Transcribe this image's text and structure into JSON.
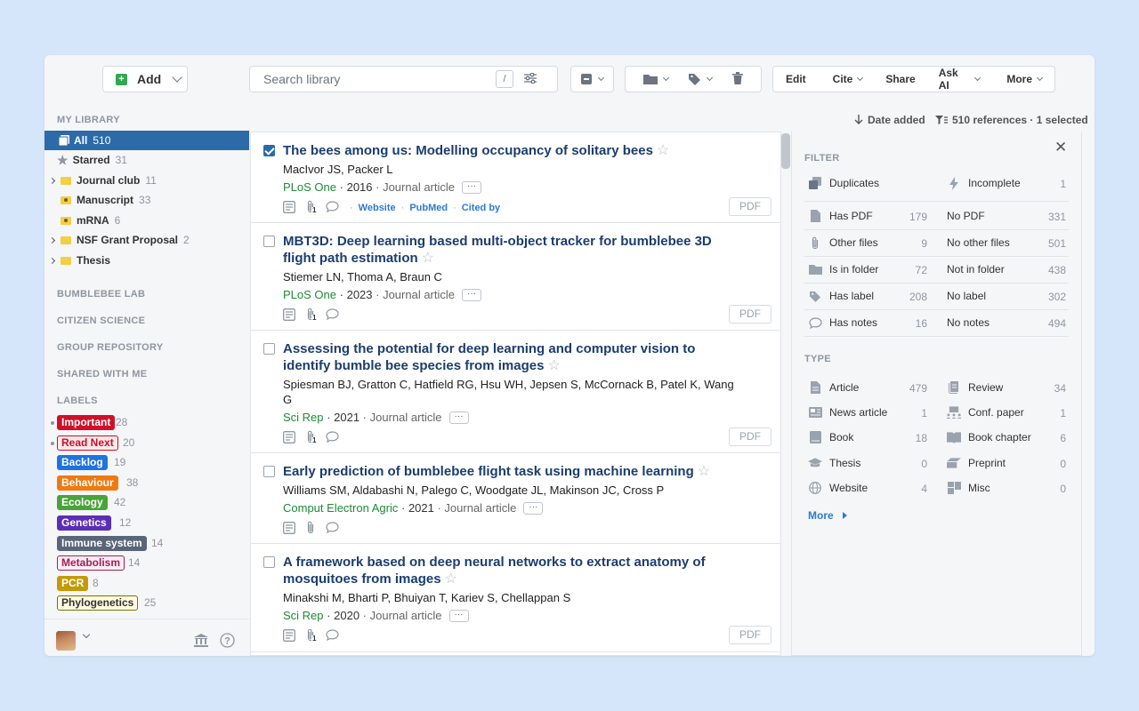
{
  "toolbar": {
    "add_label": "Add",
    "search_placeholder": "Search library",
    "slash_key": "/",
    "actions": [
      "Edit",
      "Cite",
      "Share",
      "Ask AI",
      "More"
    ]
  },
  "sidebar": {
    "my_library": "MY LIBRARY",
    "items": [
      {
        "label": "All",
        "count": "510"
      },
      {
        "label": "Starred",
        "count": "31"
      },
      {
        "label": "Journal club",
        "count": "11"
      },
      {
        "label": "Manuscript",
        "count": "33"
      },
      {
        "label": "mRNA",
        "count": "6"
      },
      {
        "label": "NSF Grant Proposal",
        "count": "2"
      },
      {
        "label": "Thesis",
        "count": ""
      }
    ],
    "groups": [
      "BUMBLEBEE LAB",
      "CITIZEN SCIENCE",
      "GROUP REPOSITORY",
      "SHARED WITH ME"
    ],
    "labels_heading": "LABELS",
    "labels": [
      {
        "name": "Important",
        "count": "28",
        "bg": "#d0102a",
        "fg": "#ffffff",
        "border": "#d0102a"
      },
      {
        "name": "Read Next",
        "count": "20",
        "bg": "#fde8ea",
        "fg": "#c81028",
        "border": "#c81028"
      },
      {
        "name": "Backlog",
        "count": "19",
        "bg": "#1f73e0",
        "fg": "#ffffff",
        "border": "#1f73e0"
      },
      {
        "name": "Behaviour",
        "count": "38",
        "bg": "#ef7a12",
        "fg": "#ffffff",
        "border": "#ef7a12"
      },
      {
        "name": "Ecology",
        "count": "42",
        "bg": "#4aa33a",
        "fg": "#ffffff",
        "border": "#4aa33a"
      },
      {
        "name": "Genetics",
        "count": "12",
        "bg": "#5b2fb5",
        "fg": "#ffffff",
        "border": "#5b2fb5"
      },
      {
        "name": "Immune system",
        "count": "14",
        "bg": "#5a6577",
        "fg": "#ffffff",
        "border": "#5a6577"
      },
      {
        "name": "Metabolism",
        "count": "14",
        "bg": "#fbeef3",
        "fg": "#a0205a",
        "border": "#a0205a"
      },
      {
        "name": "PCR",
        "count": "8",
        "bg": "#c49a06",
        "fg": "#ffffff",
        "border": "#c49a06"
      },
      {
        "name": "Phylogenetics",
        "count": "25",
        "bg": "#fefbe0",
        "fg": "#333333",
        "border": "#7a7400"
      }
    ]
  },
  "list_header": {
    "sort": "Date added",
    "summary": "510 references · 1 selected"
  },
  "references": [
    {
      "title": "The bees among us: Modelling occupancy of solitary bees",
      "authors": "MacIvor JS, Packer L",
      "journal": "PLoS One",
      "year": "2016",
      "type": "Journal article",
      "links": [
        "Website",
        "PubMed",
        "Cited by"
      ],
      "pdf": "PDF",
      "checked": true,
      "clip": "1"
    },
    {
      "title": "MBT3D: Deep learning based multi-object tracker for bumblebee 3D flight path estimation",
      "authors": "Stiemer LN, Thoma A, Braun C",
      "journal": "PLoS One",
      "year": "2023",
      "type": "Journal article",
      "links": [],
      "pdf": "PDF",
      "checked": false,
      "clip": "1"
    },
    {
      "title": "Assessing the potential for deep learning and computer vision to identify bumble bee species from images",
      "authors": "Spiesman BJ, Gratton C, Hatfield RG, Hsu WH, Jepsen S, McCornack B, Patel K, Wang G",
      "journal": "Sci Rep",
      "year": "2021",
      "type": "Journal article",
      "links": [],
      "pdf": "PDF",
      "checked": false,
      "clip": "1"
    },
    {
      "title": "Early prediction of bumblebee flight task using machine learning",
      "authors": "Williams SM, Aldabashi N, Palego C, Woodgate JL, Makinson JC, Cross P",
      "journal": "Comput Electron Agric",
      "year": "2021",
      "type": "Journal article",
      "links": [],
      "pdf": "",
      "checked": false,
      "clip": ""
    },
    {
      "title": "A framework based on deep neural networks to extract anatomy of mosquitoes from images",
      "authors": "Minakshi M, Bharti P, Bhuiyan T, Kariev S, Chellappan S",
      "journal": "Sci Rep",
      "year": "2020",
      "type": "Journal article",
      "links": [],
      "pdf": "PDF",
      "checked": false,
      "clip": "1"
    }
  ],
  "filter_panel": {
    "filter_heading": "FILTER",
    "duplicates": "Duplicates",
    "incomplete": "Incomplete",
    "incomplete_count": "1",
    "rows": [
      {
        "left": "Has PDF",
        "left_count": "179",
        "right": "No PDF",
        "right_count": "331"
      },
      {
        "left": "Other files",
        "left_count": "9",
        "right": "No other files",
        "right_count": "501"
      },
      {
        "left": "Is in folder",
        "left_count": "72",
        "right": "Not in folder",
        "right_count": "438"
      },
      {
        "left": "Has label",
        "left_count": "208",
        "right": "No label",
        "right_count": "302"
      },
      {
        "left": "Has notes",
        "left_count": "16",
        "right": "No notes",
        "right_count": "494"
      }
    ],
    "type_heading": "TYPE",
    "types": [
      {
        "left": "Article",
        "left_count": "479",
        "right": "Review",
        "right_count": "34"
      },
      {
        "left": "News article",
        "left_count": "1",
        "right": "Conf. paper",
        "right_count": "1"
      },
      {
        "left": "Book",
        "left_count": "18",
        "right": "Book chapter",
        "right_count": "6"
      },
      {
        "left": "Thesis",
        "left_count": "0",
        "right": "Preprint",
        "right_count": "0"
      },
      {
        "left": "Website",
        "left_count": "4",
        "right": "Misc",
        "right_count": "0"
      }
    ],
    "more": "More"
  }
}
